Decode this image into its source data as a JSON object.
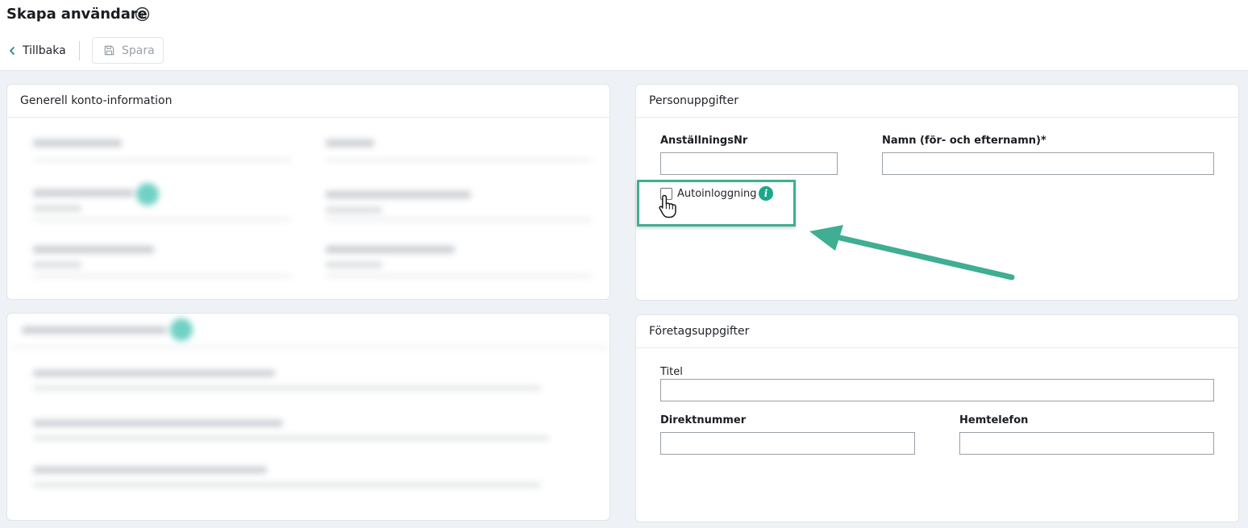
{
  "header": {
    "title": "Skapa användare",
    "back_label": "Tillbaka",
    "save_label": "Spara"
  },
  "cards": {
    "general": {
      "title": "Generell konto-information"
    },
    "person": {
      "title": "Personuppgifter",
      "employee_no_label": "AnställningsNr",
      "employee_no_value": "",
      "name_label": "Namn (för- och efternamn)*",
      "name_value": "",
      "autologin_label": "Autoinloggning",
      "autologin_info": "i"
    },
    "company": {
      "title": "Företagsuppgifter",
      "title_label": "Titel",
      "title_value": "",
      "direct_label": "Direktnummer",
      "direct_value": "",
      "home_label": "Hemtelefon",
      "home_value": ""
    }
  },
  "colors": {
    "accent": "#1aa88a",
    "highlight": "#3fae92",
    "page_bg": "#eef1f5"
  },
  "icons": {
    "title_info": "info-circle-icon",
    "back": "chevron-left-icon",
    "save": "floppy-disk-icon",
    "cursor": "hand-pointer-icon",
    "arrow": "arrow-left-icon"
  }
}
